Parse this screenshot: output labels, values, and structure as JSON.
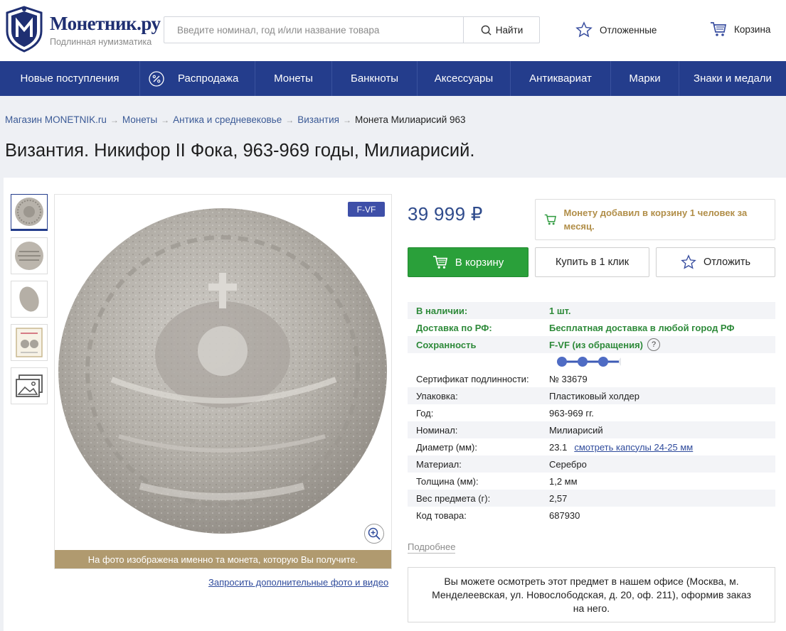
{
  "header": {
    "logo_title": "Монетник.ру",
    "logo_subtitle": "Подлинная нумизматика",
    "search_placeholder": "Введите номинал, год и/или название товара",
    "search_button": "Найти",
    "wishlist_label": "Отложенные",
    "cart_label": "Корзина"
  },
  "nav": {
    "items": [
      {
        "label": "Новые поступления"
      },
      {
        "label": "Распродажа",
        "icon": "percent-icon"
      },
      {
        "label": "Монеты"
      },
      {
        "label": "Банкноты"
      },
      {
        "label": "Аксессуары"
      },
      {
        "label": "Антиквариат"
      },
      {
        "label": "Марки"
      },
      {
        "label": "Знаки и медали"
      }
    ]
  },
  "breadcrumb": {
    "items": [
      "Магазин MONETNIK.ru",
      "Монеты",
      "Антика и средневековье",
      "Византия"
    ],
    "current": "Монета Милиарисий 963"
  },
  "product": {
    "title": "Византия. Никифор II Фока, 963-969 годы, Милиарисий.",
    "grade_badge": "F-VF",
    "photo_caption": "На фото изображена именно та монета, которую Вы получите.",
    "request_photo_link": "Запросить дополнительные фото и видео",
    "price": "39 999 ₽",
    "cart_notice": "Монету добавил в корзину 1 человек за месяц.",
    "add_to_cart": "В корзину",
    "buy_one_click": "Купить в 1 клик",
    "postpone": "Отложить",
    "condition_scale": {
      "filled": 3,
      "total": 7
    },
    "specs_primary": [
      {
        "key": "В наличии:",
        "value": "1 шт."
      },
      {
        "key": "Доставка по РФ:",
        "value": "Бесплатная доставка в любой город РФ"
      },
      {
        "key": "Сохранность",
        "value": "F-VF (из обращения)"
      }
    ],
    "specs": [
      {
        "key": "Сертификат подлинности:",
        "value": "№ 33679"
      },
      {
        "key": "Упаковка:",
        "value": "Пластиковый холдер"
      },
      {
        "key": "Год:",
        "value": "963-969 гг."
      },
      {
        "key": "Номинал:",
        "value": "Милиарисий"
      },
      {
        "key": "Диаметр (мм):",
        "value": "23.1",
        "link": "смотреть капсулы 24-25 мм"
      },
      {
        "key": "Материал:",
        "value": "Серебро"
      },
      {
        "key": "Толщина (мм):",
        "value": "1,2 мм"
      },
      {
        "key": "Вес предмета (г):",
        "value": "2,57"
      },
      {
        "key": "Код товара:",
        "value": "687930"
      }
    ],
    "more_link": "Подробнее",
    "office_note": "Вы можете осмотреть этот предмет в нашем офисе (Москва, м. Менделеевская, ул. Новослободская, д. 20, оф. 211), оформив заказ на него."
  },
  "colors": {
    "nav_bg": "#243d8c",
    "cart_green": "#2aa03a",
    "price_blue": "#2f4b8c",
    "notice_gold": "#b18e48",
    "caption_gold": "#b09a6f"
  }
}
